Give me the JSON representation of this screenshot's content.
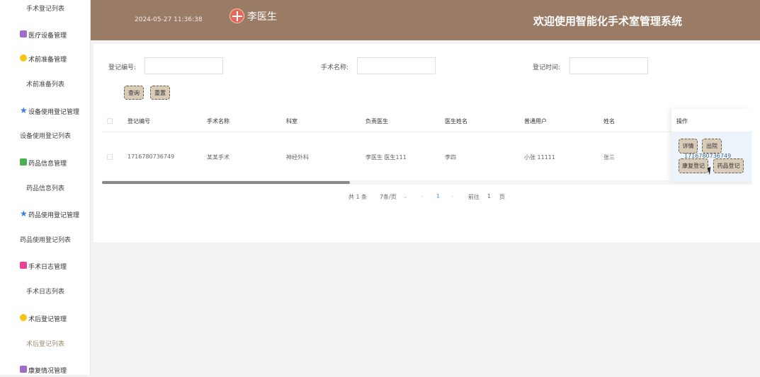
{
  "sidebar": {
    "items": [
      {
        "label": "手术登记列表",
        "kind": "sub"
      },
      {
        "label": "医疗设备管理",
        "kind": "group",
        "icon": "box-icon",
        "color": "#a06cc9"
      },
      {
        "label": "术前准备管理",
        "kind": "group",
        "icon": "smile-icon",
        "color": "#f5c518"
      },
      {
        "label": "术前准备列表",
        "kind": "sub"
      },
      {
        "label": "设备使用登记管理",
        "kind": "group",
        "icon": "star-icon",
        "color": "#3b7de0"
      },
      {
        "label": "设备使用登记列表",
        "kind": "sub"
      },
      {
        "label": "药品信息管理",
        "kind": "group",
        "icon": "chat-icon",
        "color": "#4caf50"
      },
      {
        "label": "药品信息列表",
        "kind": "sub"
      },
      {
        "label": "药品使用登记管理",
        "kind": "group",
        "icon": "star-icon",
        "color": "#3b7de0"
      },
      {
        "label": "药品使用登记列表",
        "kind": "sub"
      },
      {
        "label": "手术日志管理",
        "kind": "group",
        "icon": "doc-icon",
        "color": "#e84393"
      },
      {
        "label": "手术日志列表",
        "kind": "sub"
      },
      {
        "label": "术后登记管理",
        "kind": "group",
        "icon": "smile-icon",
        "color": "#f5c518"
      },
      {
        "label": "术后登记列表",
        "kind": "sub",
        "active": true
      },
      {
        "label": "康复情况管理",
        "kind": "group",
        "icon": "box-icon",
        "color": "#a06cc9"
      }
    ]
  },
  "header": {
    "datetime": "2024-05-27 11:36:38",
    "username": "李医生",
    "welcome": "欢迎使用智能化手术室管理系统",
    "bg_color": "#9a7b65"
  },
  "search": {
    "reg_no_label": "登记编号:",
    "surgery_name_label": "手术名称:",
    "reg_time_label": "登记时间:",
    "query_button": "查询",
    "reset_button": "重置"
  },
  "table": {
    "headers": [
      "登记编号",
      "手术名称",
      "科室",
      "负责医生",
      "医生姓名",
      "普通用户",
      "姓名",
      "操作"
    ],
    "rows": [
      {
        "reg_no": "1716780736749",
        "surgery_name": "某某手术",
        "department": "神经外科",
        "doctor": "李医生 医生111",
        "doctor_name": "李四",
        "user": "小张 11111",
        "name": "张三"
      }
    ],
    "row_actions": [
      "详情",
      "出院",
      "康复登记",
      "药品登记"
    ]
  },
  "pagination": {
    "total": "共 1 条",
    "page_size": "7条/页",
    "current_page": "1",
    "goto_label": "前往",
    "goto_value": "1",
    "page_unit": "页"
  },
  "overlay_text": "1716780736749"
}
